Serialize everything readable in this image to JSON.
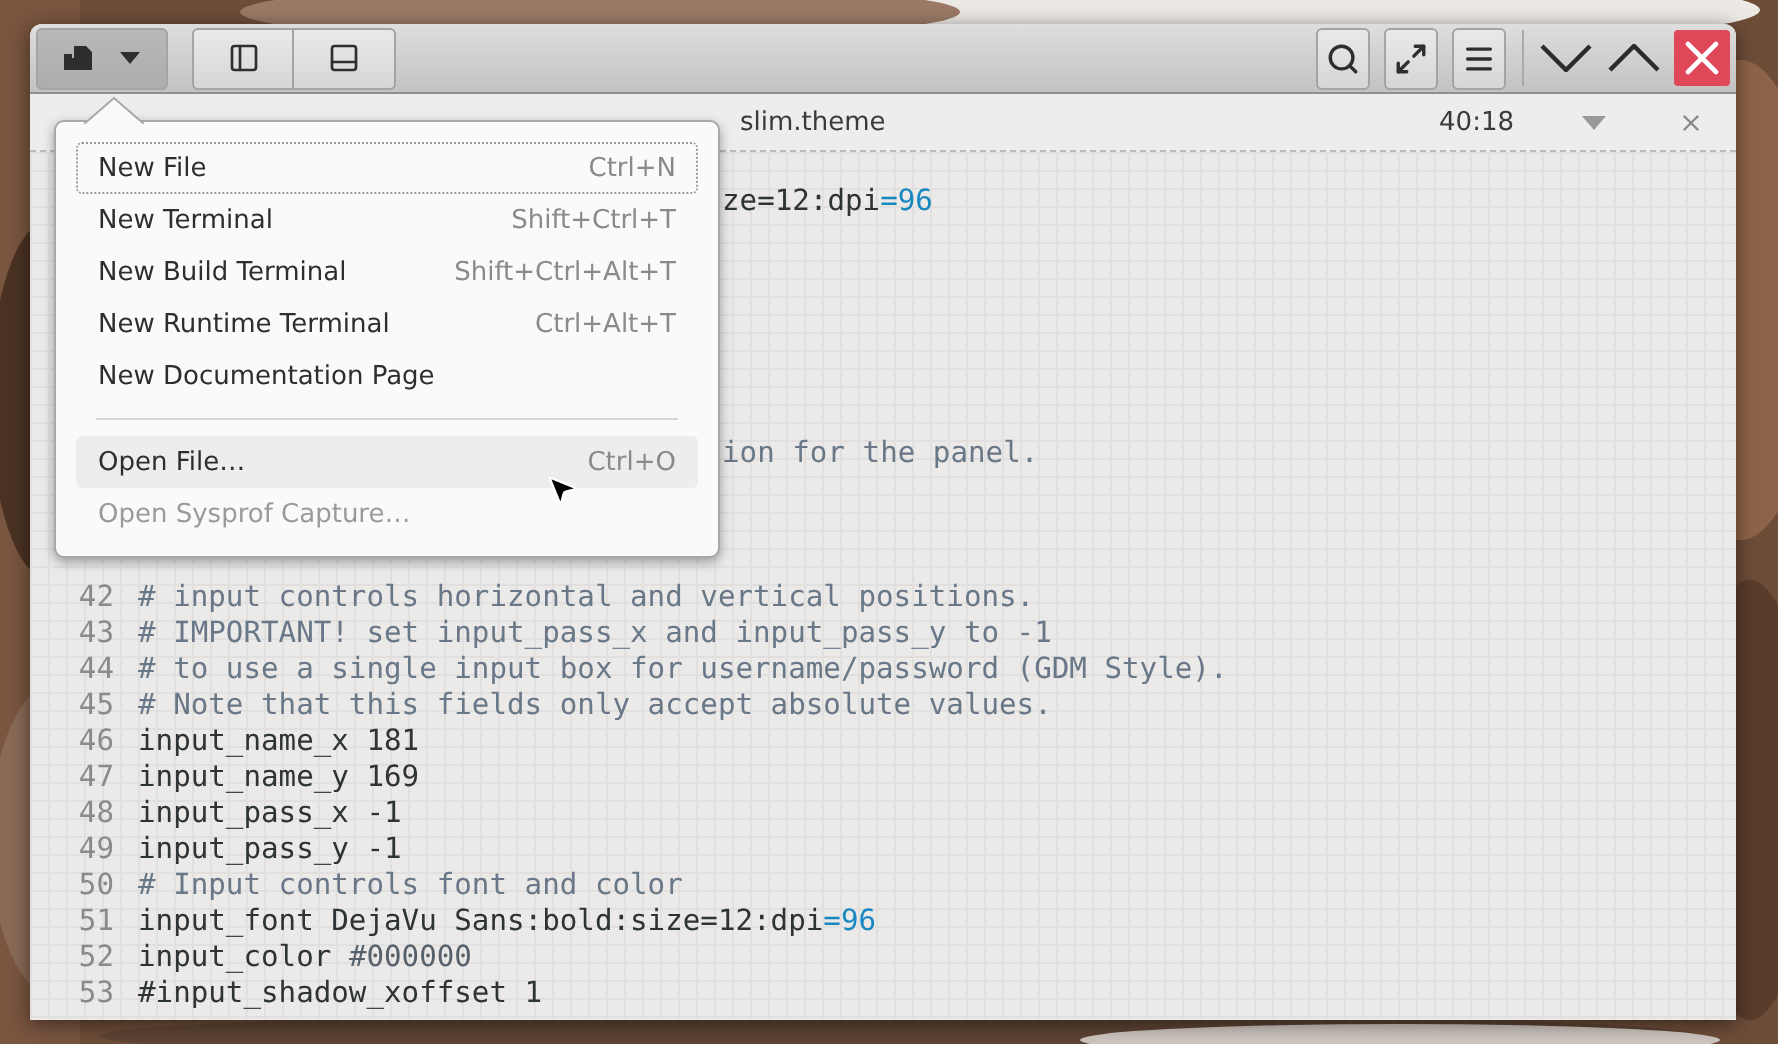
{
  "header": {
    "left_buttons": [
      {
        "kind": "new-document",
        "active": true
      },
      {
        "kind": "sidebar",
        "active": false
      },
      {
        "kind": "bottom-panel",
        "active": false
      }
    ],
    "right_buttons": [
      {
        "kind": "search"
      },
      {
        "kind": "fullscreen"
      },
      {
        "kind": "menu"
      }
    ],
    "window_controls": [
      {
        "kind": "minimize"
      },
      {
        "kind": "maximize"
      },
      {
        "kind": "close"
      }
    ]
  },
  "document": {
    "title": "slim.theme",
    "position": "40:18"
  },
  "editor": {
    "lines": [
      {
        "kind": "partial",
        "tokens": [
          {
            "text": "ze=12:dpi",
            "kind": "plain"
          },
          {
            "text": "=96",
            "kind": "number"
          }
        ]
      },
      {
        "kind": "covered"
      },
      {
        "kind": "covered"
      },
      {
        "kind": "covered"
      },
      {
        "kind": "covered"
      },
      {
        "kind": "covered"
      },
      {
        "kind": "covered"
      },
      {
        "kind": "partial",
        "tokens": [
          {
            "text": "ion for the panel.",
            "kind": "comment"
          }
        ]
      },
      {
        "kind": "covered"
      },
      {
        "kind": "covered"
      },
      {
        "kind": "covered"
      },
      {
        "kind": "full",
        "number": "42",
        "tokens": [
          {
            "text": "# input controls horizontal and vertical positions.",
            "kind": "comment"
          }
        ]
      },
      {
        "kind": "full",
        "number": "43",
        "tokens": [
          {
            "text": "# IMPORTANT! set input_pass_x and input_pass_y to -1",
            "kind": "comment"
          }
        ]
      },
      {
        "kind": "full",
        "number": "44",
        "tokens": [
          {
            "text": "# to use a single input box for username/password (GDM Style).",
            "kind": "comment"
          }
        ]
      },
      {
        "kind": "full",
        "number": "45",
        "tokens": [
          {
            "text": "# Note that this fields only accept absolute values.",
            "kind": "comment"
          }
        ]
      },
      {
        "kind": "full",
        "number": "46",
        "tokens": [
          {
            "text": "input_name_x 181",
            "kind": "plain"
          }
        ]
      },
      {
        "kind": "full",
        "number": "47",
        "tokens": [
          {
            "text": "input_name_y 169",
            "kind": "plain"
          }
        ]
      },
      {
        "kind": "full",
        "number": "48",
        "tokens": [
          {
            "text": "input_pass_x -1",
            "kind": "plain"
          }
        ]
      },
      {
        "kind": "full",
        "number": "49",
        "tokens": [
          {
            "text": "input_pass_y -1",
            "kind": "plain"
          }
        ]
      },
      {
        "kind": "full",
        "number": "50",
        "tokens": [
          {
            "text": "# Input controls font and color",
            "kind": "comment"
          }
        ]
      },
      {
        "kind": "full",
        "number": "51",
        "tokens": [
          {
            "text": "input_font DejaVu Sans:bold:size=12:dpi",
            "kind": "plain"
          },
          {
            "text": "=96",
            "kind": "number"
          }
        ]
      },
      {
        "kind": "full",
        "number": "52",
        "tokens": [
          {
            "text": "input_color ",
            "kind": "plain"
          },
          {
            "text": "#000000",
            "kind": "color"
          }
        ]
      },
      {
        "kind": "full",
        "number": "53",
        "tokens": [
          {
            "text": "#input_shadow_xoffset 1",
            "kind": "plain"
          }
        ]
      }
    ]
  },
  "menu": {
    "items": [
      {
        "kind": "item",
        "label": "New File",
        "shortcut": "Ctrl+N",
        "focused": true,
        "hovered": false,
        "disabled": false
      },
      {
        "kind": "item",
        "label": "New Terminal",
        "shortcut": "Shift+Ctrl+T",
        "focused": false,
        "hovered": false,
        "disabled": false
      },
      {
        "kind": "item",
        "label": "New Build Terminal",
        "shortcut": "Shift+Ctrl+Alt+T",
        "focused": false,
        "hovered": false,
        "disabled": false
      },
      {
        "kind": "item",
        "label": "New Runtime Terminal",
        "shortcut": "Ctrl+Alt+T",
        "focused": false,
        "hovered": false,
        "disabled": false
      },
      {
        "kind": "item",
        "label": "New Documentation Page",
        "focused": false,
        "hovered": false,
        "disabled": false
      },
      {
        "kind": "separator"
      },
      {
        "kind": "item",
        "label": "Open File…",
        "shortcut": "Ctrl+O",
        "focused": false,
        "hovered": true,
        "disabled": false
      },
      {
        "kind": "item",
        "label": "Open Sysprof Capture…",
        "focused": false,
        "hovered": false,
        "disabled": true
      }
    ]
  }
}
